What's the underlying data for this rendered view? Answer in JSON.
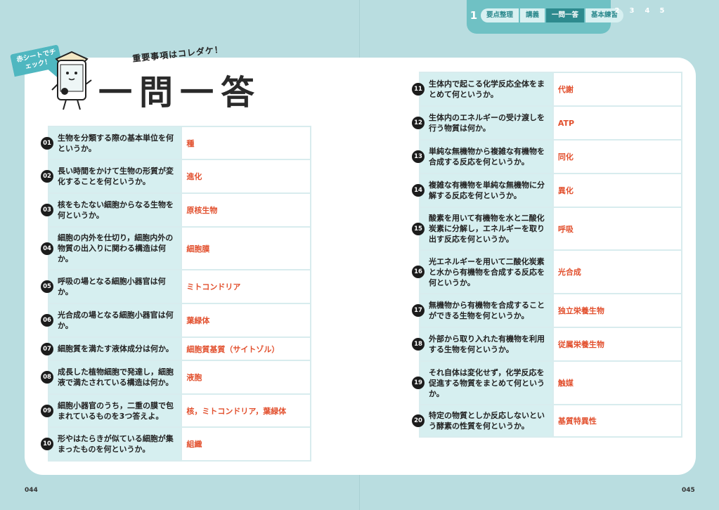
{
  "header": {
    "chapter_number": "1",
    "steps": [
      "要点整理",
      "講義",
      "一問一答",
      "基本練習"
    ],
    "active_step": "一問一答",
    "other_chapters": [
      "2",
      "3",
      "4",
      "5"
    ]
  },
  "badge_text": "赤シートでチェック！",
  "subtitle": "重要事項はコレダケ！",
  "title": "一問一答",
  "left_items": [
    {
      "num": "01",
      "question": "生物を分類する際の基本単位を何というか。",
      "answer": "種"
    },
    {
      "num": "02",
      "question": "長い時間をかけて生物の形質が変化することを何というか。",
      "answer": "進化"
    },
    {
      "num": "03",
      "question": "核をもたない細胞からなる生物を何というか。",
      "answer": "原核生物"
    },
    {
      "num": "04",
      "question": "細胞の内外を仕切り，細胞内外の物質の出入りに関わる構造は何か。",
      "answer": "細胞膜"
    },
    {
      "num": "05",
      "question": "呼吸の場となる細胞小器官は何か。",
      "answer": "ミトコンドリア"
    },
    {
      "num": "06",
      "question": "光合成の場となる細胞小器官は何か。",
      "answer": "葉緑体"
    },
    {
      "num": "07",
      "question": "細胞質を満たす液体成分は何か。",
      "answer": "細胞質基質（サイトゾル）"
    },
    {
      "num": "08",
      "question": "成長した植物細胞で発達し，細胞液で満たされている構造は何か。",
      "answer": "液胞"
    },
    {
      "num": "09",
      "question": "細胞小器官のうち，二重の膜で包まれているものを3つ答えよ。",
      "answer": "核，ミトコンドリア，葉緑体"
    },
    {
      "num": "10",
      "question": "形やはたらきが似ている細胞が集まったものを何というか。",
      "answer": "組織"
    }
  ],
  "right_items": [
    {
      "num": "11",
      "question": "生体内で起こる化学反応全体をまとめて何というか。",
      "answer": "代謝"
    },
    {
      "num": "12",
      "question": "生体内のエネルギーの受け渡しを行う物質は何か。",
      "answer": "ATP"
    },
    {
      "num": "13",
      "question": "単純な無機物から複雑な有機物を合成する反応を何というか。",
      "answer": "同化"
    },
    {
      "num": "14",
      "question": "複雑な有機物を単純な無機物に分解する反応を何というか。",
      "answer": "異化"
    },
    {
      "num": "15",
      "question": "酸素を用いて有機物を水と二酸化炭素に分解し，エネルギーを取り出す反応を何というか。",
      "answer": "呼吸"
    },
    {
      "num": "16",
      "question": "光エネルギーを用いて二酸化炭素と水から有機物を合成する反応を何というか。",
      "answer": "光合成"
    },
    {
      "num": "17",
      "question": "無機物から有機物を合成することができる生物を何というか。",
      "answer": "独立栄養生物"
    },
    {
      "num": "18",
      "question": "外部から取り入れた有機物を利用する生物を何というか。",
      "answer": "従属栄養生物"
    },
    {
      "num": "19",
      "question": "それ自体は変化せず，化学反応を促進する物質をまとめて何というか。",
      "answer": "触媒"
    },
    {
      "num": "20",
      "question": "特定の物質としか反応しないという酵素の性質を何というか。",
      "answer": "基質特異性"
    }
  ],
  "page_left": "044",
  "page_right": "045"
}
